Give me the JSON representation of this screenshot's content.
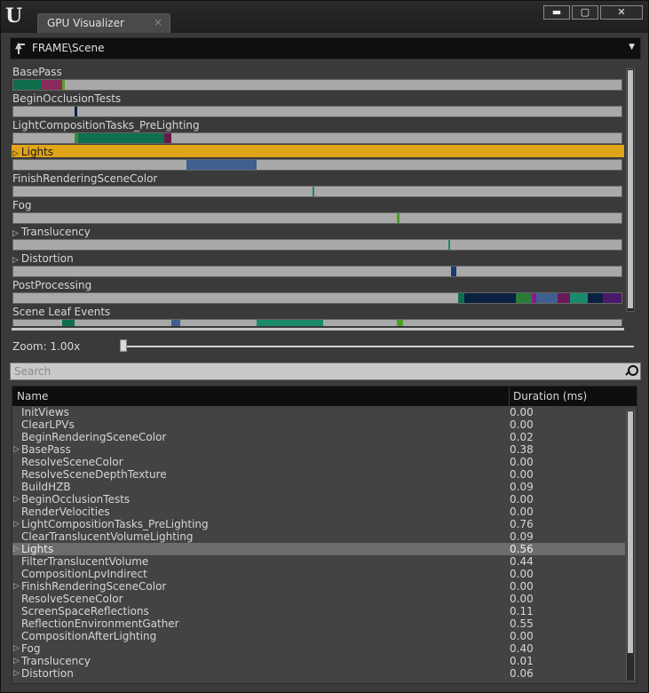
{
  "window": {
    "logo": "U",
    "tab_title": "GPU Visualizer",
    "tab_close": "×",
    "buttons": {
      "minimize": "▬",
      "maximize": "▢",
      "close": "✕"
    }
  },
  "breadcrumb": {
    "path": "FRAME\\Scene",
    "dropdown_icon": "▼"
  },
  "timeline": {
    "rows": [
      {
        "label": "BasePass",
        "expandable": false,
        "selected": false,
        "segments": [
          {
            "start": 0.0,
            "end": 0.046,
            "color": "#0f6e4c"
          },
          {
            "start": 0.046,
            "end": 0.08,
            "color": "#8a2a5a"
          },
          {
            "start": 0.08,
            "end": 0.084,
            "color": "#5aa02a"
          }
        ]
      },
      {
        "label": "BeginOcclusionTests",
        "expandable": false,
        "selected": false,
        "segments": [
          {
            "start": 0.1,
            "end": 0.104,
            "color": "#0a2040"
          }
        ]
      },
      {
        "label": "LightCompositionTasks_PreLighting",
        "expandable": false,
        "selected": false,
        "segments": [
          {
            "start": 0.1,
            "end": 0.107,
            "color": "#3a8a3a"
          },
          {
            "start": 0.107,
            "end": 0.248,
            "color": "#0f6e4c"
          },
          {
            "start": 0.248,
            "end": 0.259,
            "color": "#6a1a4a"
          }
        ]
      },
      {
        "label": "Lights",
        "expandable": true,
        "selected": true,
        "segments": [
          {
            "start": 0.284,
            "end": 0.399,
            "color": "#3e5f8f"
          }
        ]
      },
      {
        "label": "FinishRenderingSceneColor",
        "expandable": false,
        "selected": false,
        "segments": [
          {
            "start": 0.492,
            "end": 0.495,
            "color": "#1a8a5a"
          }
        ]
      },
      {
        "label": "Fog",
        "expandable": false,
        "selected": false,
        "segments": [
          {
            "start": 0.631,
            "end": 0.635,
            "color": "#4aa020"
          }
        ]
      },
      {
        "label": "Translucency",
        "expandable": true,
        "selected": false,
        "segments": [
          {
            "start": 0.716,
            "end": 0.719,
            "color": "#1a8a6a"
          }
        ]
      },
      {
        "label": "Distortion",
        "expandable": true,
        "selected": false,
        "segments": [
          {
            "start": 0.72,
            "end": 0.729,
            "color": "#1a3a70"
          }
        ]
      },
      {
        "label": "PostProcessing",
        "expandable": false,
        "selected": false,
        "segments": [
          {
            "start": 0.731,
            "end": 0.742,
            "color": "#0f6e4c"
          },
          {
            "start": 0.742,
            "end": 0.826,
            "color": "#0a2040"
          },
          {
            "start": 0.826,
            "end": 0.852,
            "color": "#2a7a3a"
          },
          {
            "start": 0.852,
            "end": 0.86,
            "color": "#8a1a8a"
          },
          {
            "start": 0.86,
            "end": 0.895,
            "color": "#3e5f8f"
          },
          {
            "start": 0.895,
            "end": 0.915,
            "color": "#6a1a5a"
          },
          {
            "start": 0.915,
            "end": 0.945,
            "color": "#1a8a6a"
          },
          {
            "start": 0.945,
            "end": 0.97,
            "color": "#0a2040"
          },
          {
            "start": 0.97,
            "end": 1.0,
            "color": "#4a1a6a"
          }
        ]
      },
      {
        "label": "Scene Leaf Events",
        "expandable": false,
        "selected": false,
        "segments": [
          {
            "start": 0.08,
            "end": 0.1,
            "color": "#0f6e4c"
          },
          {
            "start": 0.26,
            "end": 0.275,
            "color": "#3e5f8f"
          },
          {
            "start": 0.4,
            "end": 0.51,
            "color": "#1a8a6a"
          },
          {
            "start": 0.63,
            "end": 0.64,
            "color": "#4aa020"
          }
        ]
      }
    ]
  },
  "zoom": {
    "label": "Zoom: 1.00x",
    "value": 0.0
  },
  "search": {
    "placeholder": "Search"
  },
  "table": {
    "headers": {
      "name": "Name",
      "duration": "Duration (ms)"
    },
    "rows": [
      {
        "name": "InitViews",
        "duration": "0.00",
        "expandable": false,
        "selected": false
      },
      {
        "name": "ClearLPVs",
        "duration": "0.00",
        "expandable": false,
        "selected": false
      },
      {
        "name": "BeginRenderingSceneColor",
        "duration": "0.02",
        "expandable": false,
        "selected": false
      },
      {
        "name": "BasePass",
        "duration": "0.38",
        "expandable": true,
        "selected": false
      },
      {
        "name": "ResolveSceneColor",
        "duration": "0.00",
        "expandable": false,
        "selected": false
      },
      {
        "name": "ResolveSceneDepthTexture",
        "duration": "0.00",
        "expandable": false,
        "selected": false
      },
      {
        "name": "BuildHZB",
        "duration": "0.09",
        "expandable": false,
        "selected": false
      },
      {
        "name": "BeginOcclusionTests",
        "duration": "0.00",
        "expandable": true,
        "selected": false
      },
      {
        "name": "RenderVelocities",
        "duration": "0.00",
        "expandable": false,
        "selected": false
      },
      {
        "name": "LightCompositionTasks_PreLighting",
        "duration": "0.76",
        "expandable": true,
        "selected": false
      },
      {
        "name": "ClearTranslucentVolumeLighting",
        "duration": "0.09",
        "expandable": false,
        "selected": false
      },
      {
        "name": "Lights",
        "duration": "0.56",
        "expandable": true,
        "selected": true
      },
      {
        "name": "FilterTranslucentVolume",
        "duration": "0.44",
        "expandable": false,
        "selected": false
      },
      {
        "name": "CompositionLpvIndirect",
        "duration": "0.00",
        "expandable": false,
        "selected": false
      },
      {
        "name": "FinishRenderingSceneColor",
        "duration": "0.00",
        "expandable": true,
        "selected": false
      },
      {
        "name": "ResolveSceneColor",
        "duration": "0.00",
        "expandable": false,
        "selected": false
      },
      {
        "name": "ScreenSpaceReflections",
        "duration": "0.11",
        "expandable": false,
        "selected": false
      },
      {
        "name": "ReflectionEnvironmentGather",
        "duration": "0.55",
        "expandable": false,
        "selected": false
      },
      {
        "name": "CompositionAfterLighting",
        "duration": "0.00",
        "expandable": false,
        "selected": false
      },
      {
        "name": "Fog",
        "duration": "0.40",
        "expandable": true,
        "selected": false
      },
      {
        "name": "Translucency",
        "duration": "0.01",
        "expandable": true,
        "selected": false
      },
      {
        "name": "Distortion",
        "duration": "0.06",
        "expandable": true,
        "selected": false
      }
    ]
  },
  "icons": {
    "expand": "expand-triangle-icon",
    "search": "search-icon",
    "up": "up-level-icon"
  }
}
